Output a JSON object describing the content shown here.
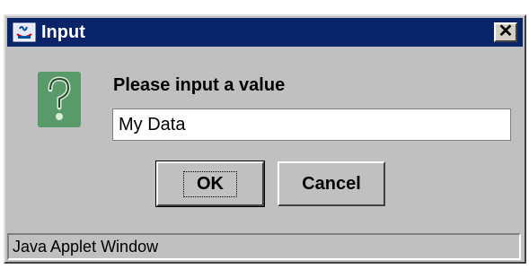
{
  "window": {
    "title": "Input",
    "close_label": "✕"
  },
  "dialog": {
    "icon": "question-icon",
    "prompt": "Please input a value",
    "input_value": "My Data"
  },
  "buttons": {
    "ok_label": "OK",
    "cancel_label": "Cancel"
  },
  "status": {
    "text": "Java Applet Window"
  },
  "colors": {
    "titlebar": "#0a246a",
    "window_bg": "#c0c0c0",
    "icon_bg": "#5a9a6a"
  }
}
